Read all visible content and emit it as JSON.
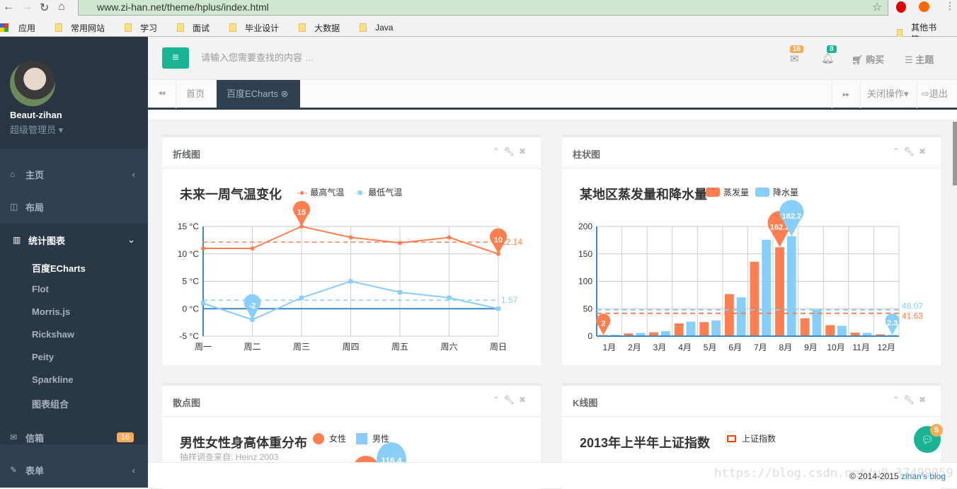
{
  "browser": {
    "url": "www.zi-han.net/theme/hplus/index.html",
    "bookmarks": [
      "应用",
      "常用网站",
      "学习",
      "面试",
      "毕业设计",
      "大数据",
      "Java"
    ],
    "other_bookmarks": "其他书签"
  },
  "sidebar": {
    "user": "Beaut-zihan",
    "role": "超级管理员",
    "items": [
      {
        "label": "主页",
        "icon": "home-icon"
      },
      {
        "label": "布局",
        "icon": "columns-icon"
      },
      {
        "label": "统计图表",
        "icon": "bar-chart-icon"
      },
      {
        "label": "信箱",
        "icon": "envelope-icon",
        "badge": "16"
      },
      {
        "label": "表单",
        "icon": "edit-icon"
      }
    ],
    "subitems": [
      "百度ECharts",
      "Flot",
      "Morris.js",
      "Rickshaw",
      "Peity",
      "Sparkline",
      "图表组合"
    ]
  },
  "header": {
    "search_placeholder": "请输入您需要查找的内容 …",
    "mail_count": "16",
    "bell_count": "8",
    "buy": "购买",
    "theme": "主题"
  },
  "tabs": {
    "home": "首页",
    "active": "百度ECharts",
    "close_ops": "关闭操作",
    "logout": "退出"
  },
  "colors": {
    "accent": "#1ab394",
    "sidebar": "#2f4050",
    "orange": "#ff7f50",
    "blue": "#87cefa",
    "badge_warn": "#f8ac59"
  },
  "panels": [
    {
      "title": "折线图",
      "chart_title": "未来一周气温变化"
    },
    {
      "title": "柱状图",
      "chart_title": "某地区蒸发量和降水量"
    },
    {
      "title": "散点图",
      "chart_title": "男性女性身高体重分布",
      "subtitle": "抽样调查来自: Heinz  2003",
      "legend": [
        "女性",
        "男性"
      ],
      "marker": "116.4"
    },
    {
      "title": "K线图",
      "chart_title": "2013年上半年上证指数",
      "legend": [
        "上证指数"
      ]
    }
  ],
  "chat_badge": "5",
  "footer": {
    "copyright": "© 2014-2015",
    "link": "zihan's blog",
    "watermark": "https://blog.csdn.net/u0_37499059"
  },
  "chart_data": [
    {
      "type": "line",
      "title": "未来一周气温变化",
      "categories": [
        "周一",
        "周二",
        "周三",
        "周四",
        "周五",
        "周六",
        "周日"
      ],
      "series": [
        {
          "name": "最高气温",
          "values": [
            11,
            11,
            15,
            13,
            12,
            13,
            10
          ],
          "color": "#ff7f50",
          "max": 15,
          "min": 10,
          "average": "12.14"
        },
        {
          "name": "最低气温",
          "values": [
            1,
            -2,
            2,
            5,
            3,
            2,
            0
          ],
          "color": "#87cefa",
          "min": -2,
          "average": "1.57"
        }
      ],
      "ylim": [
        -5,
        15
      ],
      "yticks": [
        "15 °C",
        "10 °C",
        "5 °C",
        "0 °C",
        "-5 °C"
      ],
      "grid": true,
      "legend": "top"
    },
    {
      "type": "bar",
      "title": "某地区蒸发量和降水量",
      "categories": [
        "1月",
        "2月",
        "3月",
        "4月",
        "5月",
        "6月",
        "7月",
        "8月",
        "9月",
        "10月",
        "11月",
        "12月"
      ],
      "series": [
        {
          "name": "蒸发量",
          "values": [
            2.0,
            4.9,
            7.0,
            23.2,
            25.6,
            76.7,
            135.6,
            162.2,
            32.6,
            20.0,
            6.4,
            3.3
          ],
          "color": "#ff7f50",
          "max": "162.2",
          "min": "2",
          "average": "41.63"
        },
        {
          "name": "降水量",
          "values": [
            2.6,
            5.9,
            9.0,
            26.4,
            28.7,
            70.7,
            175.6,
            182.2,
            48.7,
            18.8,
            6.0,
            2.3
          ],
          "color": "#87cefa",
          "max": "182.2",
          "min": "2.3",
          "average": "48.07"
        }
      ],
      "ylim": [
        0,
        200
      ],
      "yticks": [
        "200",
        "150",
        "100",
        "50",
        "0"
      ],
      "grid": true,
      "legend": "top"
    }
  ]
}
